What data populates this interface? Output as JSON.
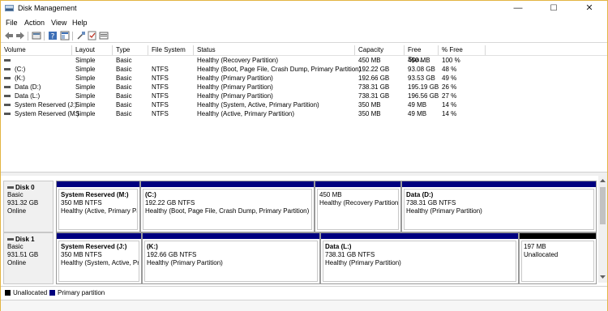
{
  "window": {
    "title": "Disk Management",
    "controls": {
      "minimize": "—",
      "maximize": "☐",
      "close": "✕"
    }
  },
  "menu": [
    {
      "label": "File"
    },
    {
      "label": "Action"
    },
    {
      "label": "View"
    },
    {
      "label": "Help"
    }
  ],
  "toolbar": {
    "icons": [
      "back-icon",
      "forward-icon",
      "properties-icon",
      "help-icon",
      "show-hide-icon",
      "connect-icon",
      "check-icon",
      "settings-icon"
    ]
  },
  "columns": [
    "Volume",
    "Layout",
    "Type",
    "File System",
    "Status",
    "Capacity",
    "Free Spa...",
    "% Free"
  ],
  "volumes": [
    {
      "volume": "",
      "layout": "Simple",
      "type": "Basic",
      "fs": "",
      "status": "Healthy (Recovery Partition)",
      "capacity": "450 MB",
      "free": "450 MB",
      "pct": "100 %"
    },
    {
      "volume": "(C:)",
      "layout": "Simple",
      "type": "Basic",
      "fs": "NTFS",
      "status": "Healthy (Boot, Page File, Crash Dump, Primary Partition)",
      "capacity": "192.22 GB",
      "free": "93.08 GB",
      "pct": "48 %"
    },
    {
      "volume": "(K:)",
      "layout": "Simple",
      "type": "Basic",
      "fs": "NTFS",
      "status": "Healthy (Primary Partition)",
      "capacity": "192.66 GB",
      "free": "93.53 GB",
      "pct": "49 %"
    },
    {
      "volume": "Data (D:)",
      "layout": "Simple",
      "type": "Basic",
      "fs": "NTFS",
      "status": "Healthy (Primary Partition)",
      "capacity": "738.31 GB",
      "free": "195.19 GB",
      "pct": "26 %"
    },
    {
      "volume": "Data (L:)",
      "layout": "Simple",
      "type": "Basic",
      "fs": "NTFS",
      "status": "Healthy (Primary Partition)",
      "capacity": "738.31 GB",
      "free": "196.56 GB",
      "pct": "27 %"
    },
    {
      "volume": "System Reserved (J:)",
      "layout": "Simple",
      "type": "Basic",
      "fs": "NTFS",
      "status": "Healthy (System, Active, Primary Partition)",
      "capacity": "350 MB",
      "free": "49 MB",
      "pct": "14 %"
    },
    {
      "volume": "System Reserved (M:)",
      "layout": "Simple",
      "type": "Basic",
      "fs": "NTFS",
      "status": "Healthy (Active, Primary Partition)",
      "capacity": "350 MB",
      "free": "49 MB",
      "pct": "14 %"
    }
  ],
  "disks": [
    {
      "name": "Disk 0",
      "type": "Basic",
      "size": "931.32 GB",
      "state": "Online",
      "partitions": [
        {
          "name": "System Reserved  (M:)",
          "size": "350 MB NTFS",
          "status": "Healthy (Active, Primary Pa",
          "kind": "primary"
        },
        {
          "name": "(C:)",
          "size": "192.22 GB NTFS",
          "status": "Healthy (Boot, Page File, Crash Dump, Primary Partition)",
          "kind": "primary"
        },
        {
          "name": "",
          "size": "450 MB",
          "status": "Healthy (Recovery Partition)",
          "kind": "primary"
        },
        {
          "name": "Data  (D:)",
          "size": "738.31 GB NTFS",
          "status": "Healthy (Primary Partition)",
          "kind": "primary"
        }
      ]
    },
    {
      "name": "Disk 1",
      "type": "Basic",
      "size": "931.51 GB",
      "state": "Online",
      "partitions": [
        {
          "name": "System Reserved  (J:)",
          "size": "350 MB NTFS",
          "status": "Healthy (System, Active, Prir",
          "kind": "primary"
        },
        {
          "name": "(K:)",
          "size": "192.66 GB NTFS",
          "status": "Healthy (Primary Partition)",
          "kind": "primary"
        },
        {
          "name": "Data  (L:)",
          "size": "738.31 GB NTFS",
          "status": "Healthy (Primary Partition)",
          "kind": "primary"
        },
        {
          "name": "",
          "size": "197 MB",
          "status": "Unallocated",
          "kind": "unallocated"
        }
      ]
    }
  ],
  "legend": [
    {
      "label": "Unallocated",
      "color": "#000000"
    },
    {
      "label": "Primary partition",
      "color": "#00007f"
    }
  ],
  "colors": {
    "primary": "#00007f",
    "unallocated": "#000000",
    "accent_border": "#e3b543"
  }
}
